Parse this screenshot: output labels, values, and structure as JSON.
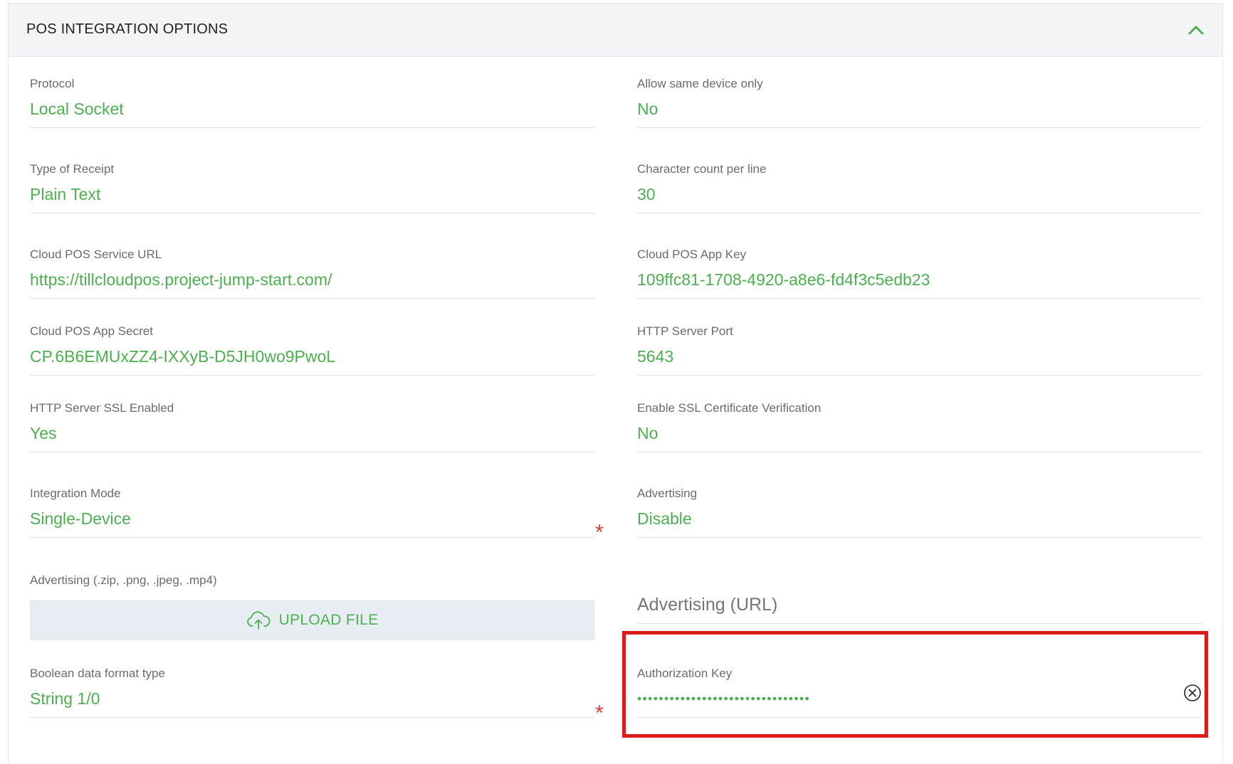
{
  "panel": {
    "title": "POS INTEGRATION OPTIONS",
    "collapse_icon": "chevron-up-icon",
    "accent_color": "#4caf50",
    "required_color": "#e53935",
    "highlight_color": "#dc1c1c"
  },
  "fields": {
    "protocol": {
      "label": "Protocol",
      "value": "Local Socket"
    },
    "allow_same_device": {
      "label": "Allow same device only",
      "value": "No"
    },
    "receipt_type": {
      "label": "Type of Receipt",
      "value": "Plain Text"
    },
    "char_count": {
      "label": "Character count per line",
      "value": "30"
    },
    "cloud_url": {
      "label": "Cloud POS Service URL",
      "value": "https://tillcloudpos.project-jump-start.com/"
    },
    "cloud_app_key": {
      "label": "Cloud POS App Key",
      "value": "109ffc81-1708-4920-a8e6-fd4f3c5edb23"
    },
    "cloud_app_secret": {
      "label": "Cloud POS App Secret",
      "value": "CP.6B6EMUxZZ4-IXXyB-D5JH0wo9PwoL"
    },
    "http_port": {
      "label": "HTTP Server Port",
      "value": "5643"
    },
    "ssl_enabled": {
      "label": "HTTP Server SSL Enabled",
      "value": "Yes"
    },
    "ssl_verify": {
      "label": "Enable SSL Certificate Verification",
      "value": "No"
    },
    "integration_mode": {
      "label": "Integration Mode",
      "value": "Single-Device",
      "required_mark": "*"
    },
    "advertising": {
      "label": "Advertising",
      "value": "Disable"
    },
    "advertising_file": {
      "label": "Advertising (.zip, .png, .jpeg, .mp4)",
      "button_label": "UPLOAD FILE",
      "icon": "cloud-upload-icon"
    },
    "advertising_url": {
      "placeholder": "Advertising (URL)"
    },
    "boolean_format": {
      "label": "Boolean data format type",
      "value": "String 1/0",
      "required_mark": "*"
    },
    "auth_key": {
      "label": "Authorization Key",
      "masked_length": 32,
      "clear_icon": "clear-circle-icon"
    }
  }
}
